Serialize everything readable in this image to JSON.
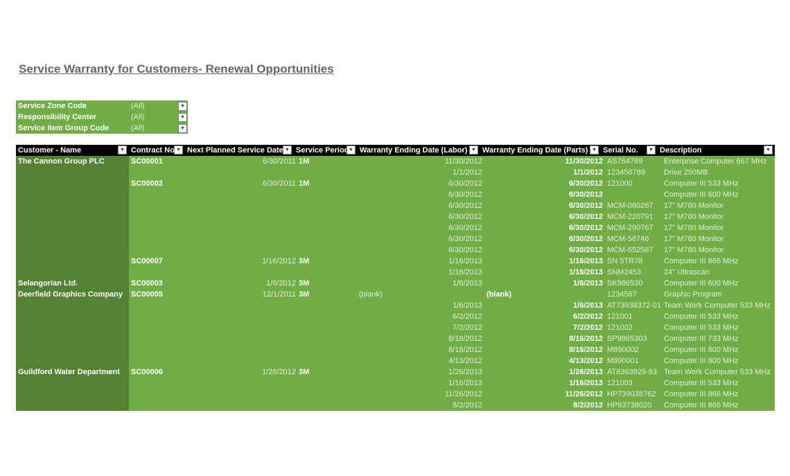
{
  "title": "Service Warranty for Customers- Renewal Opportunities",
  "filters": [
    {
      "label": "Service Zone Code",
      "value": "(All)"
    },
    {
      "label": "Responsibility Center",
      "value": "(All)"
    },
    {
      "label": "Service Item Group Code",
      "value": "(All)"
    }
  ],
  "columns": [
    "Customer - Name",
    "Contract No.",
    "Next Planned Service Date",
    "Service Period",
    "Warranty Ending Date (Labor)",
    "Warranty Ending Date (Parts)",
    "Serial No.",
    "Description"
  ],
  "rows": [
    {
      "customer": "The Cannon Group PLC",
      "contract": "SC00001",
      "next_date": "6/30/2011",
      "period": "1M",
      "labor": "11/30/2012",
      "parts": "11/30/2012",
      "serial": "AS764789",
      "desc": "Enterprise Computer 667 MHz"
    },
    {
      "customer": "",
      "contract": "",
      "next_date": "",
      "period": "",
      "labor": "1/1/2012",
      "parts": "1/1/2012",
      "serial": "123456789",
      "desc": "Drive 250MB"
    },
    {
      "customer": "",
      "contract": "SC00002",
      "next_date": "6/30/2011",
      "period": "1M",
      "labor": "6/30/2012",
      "parts": "6/30/2012",
      "serial": "121000",
      "desc": "Computer III 533 MHz"
    },
    {
      "customer": "",
      "contract": "",
      "next_date": "",
      "period": "",
      "labor": "6/30/2012",
      "parts": "6/30/2012",
      "serial": "",
      "desc": "Computer III 600 MHz"
    },
    {
      "customer": "",
      "contract": "",
      "next_date": "",
      "period": "",
      "labor": "6/30/2012",
      "parts": "6/30/2012",
      "serial": "MCM-060267",
      "desc": "17\" M780 Monitor"
    },
    {
      "customer": "",
      "contract": "",
      "next_date": "",
      "period": "",
      "labor": "6/30/2012",
      "parts": "6/30/2012",
      "serial": "MCM-220791",
      "desc": "17\" M780 Monitor"
    },
    {
      "customer": "",
      "contract": "",
      "next_date": "",
      "period": "",
      "labor": "6/30/2012",
      "parts": "6/30/2012",
      "serial": "MCM-290767",
      "desc": "17\" M780 Monitor"
    },
    {
      "customer": "",
      "contract": "",
      "next_date": "",
      "period": "",
      "labor": "6/30/2012",
      "parts": "6/30/2012",
      "serial": "MCM-58746",
      "desc": "17\" M780 Monitor"
    },
    {
      "customer": "",
      "contract": "",
      "next_date": "",
      "period": "",
      "labor": "6/30/2012",
      "parts": "6/30/2012",
      "serial": "MCM-652587",
      "desc": "17\" M780 Monitor"
    },
    {
      "customer": "",
      "contract": "SC00007",
      "next_date": "1/16/2012",
      "period": "3M",
      "labor": "1/16/2013",
      "parts": "1/16/2013",
      "serial": "SN 5TR78",
      "desc": "Computer III 866 MHz"
    },
    {
      "customer": "",
      "contract": "",
      "next_date": "",
      "period": "",
      "labor": "1/16/2013",
      "parts": "1/16/2013",
      "serial": "SNM2453",
      "desc": "24\" Ultrascan"
    },
    {
      "customer": "Selangorian Ltd.",
      "contract": "SC00003",
      "next_date": "1/6/2012",
      "period": "3M",
      "labor": "1/6/2013",
      "parts": "1/6/2013",
      "serial": "SK986530",
      "desc": "Computer III 600 MHz"
    },
    {
      "customer": "Deerfield Graphics Company",
      "contract": "SC00005",
      "next_date": "12/1/2011",
      "period": "3M",
      "labor": "(blank)",
      "parts": "(blank)",
      "serial": "1234567",
      "desc": "Graphic Program"
    },
    {
      "customer": "",
      "contract": "",
      "next_date": "",
      "period": "",
      "labor": "1/6/2013",
      "parts": "1/6/2013",
      "serial": "AT73938372-01",
      "desc": "Team Work Computer 533 MHz"
    },
    {
      "customer": "",
      "contract": "",
      "next_date": "",
      "period": "",
      "labor": "6/2/2012",
      "parts": "6/2/2012",
      "serial": "121001",
      "desc": "Computer III 533 MHz"
    },
    {
      "customer": "",
      "contract": "",
      "next_date": "",
      "period": "",
      "labor": "7/2/2012",
      "parts": "7/2/2012",
      "serial": "121002",
      "desc": "Computer III 533 MHz"
    },
    {
      "customer": "",
      "contract": "",
      "next_date": "",
      "period": "",
      "labor": "8/16/2012",
      "parts": "8/16/2012",
      "serial": "SP9865303",
      "desc": "Computer III 733 MHz"
    },
    {
      "customer": "",
      "contract": "",
      "next_date": "",
      "period": "",
      "labor": "8/16/2012",
      "parts": "8/16/2012",
      "serial": "M890002",
      "desc": "Computer III 800 MHz"
    },
    {
      "customer": "",
      "contract": "",
      "next_date": "",
      "period": "",
      "labor": "4/13/2012",
      "parts": "4/13/2012",
      "serial": "M890001",
      "desc": "Computer III 800 MHz"
    },
    {
      "customer": "Guildford Water Department",
      "contract": "SC00006",
      "next_date": "1/26/2012",
      "period": "3M",
      "labor": "1/26/2013",
      "parts": "1/26/2013",
      "serial": "AT8363929-93",
      "desc": "Team Work Computer 533 MHz"
    },
    {
      "customer": "",
      "contract": "",
      "next_date": "",
      "period": "",
      "labor": "1/16/2013",
      "parts": "1/16/2013",
      "serial": "121003",
      "desc": "Computer III 533 MHz"
    },
    {
      "customer": "",
      "contract": "",
      "next_date": "",
      "period": "",
      "labor": "11/26/2012",
      "parts": "11/26/2012",
      "serial": "HP739038762",
      "desc": "Computer III 866 MHz"
    },
    {
      "customer": "",
      "contract": "",
      "next_date": "",
      "period": "",
      "labor": "8/2/2012",
      "parts": "8/2/2012",
      "serial": "HP83738020",
      "desc": "Computer III 866 MHz"
    }
  ],
  "colors": {
    "header_bg": "#000000",
    "row_bg": "#70ad47",
    "customer_bg": "#548235",
    "title": "#666666"
  }
}
